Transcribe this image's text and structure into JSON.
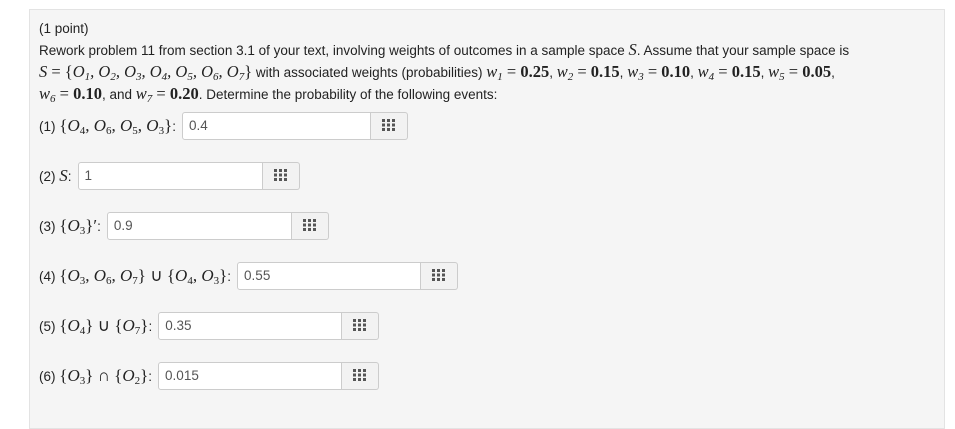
{
  "problem": {
    "points": "(1 point)",
    "intro": "Rework problem 11 from section 3.1 of your text, involving weights of outcomes in a sample space",
    "intro_tail": ". Assume that your sample space is",
    "with_weights": "with associated weights (probabilities)",
    "and_word": ", and",
    "determine": ". Determine the probability of the following events:",
    "weights": {
      "w1": "0.25",
      "w2": "0.15",
      "w3": "0.10",
      "w4": "0.15",
      "w5": "0.05",
      "w6": "0.10",
      "w7": "0.20"
    }
  },
  "answers": [
    {
      "label": "(1)",
      "value": "0.4"
    },
    {
      "label": "(2)",
      "value": "1"
    },
    {
      "label": "(3)",
      "value": "0.9"
    },
    {
      "label": "(4)",
      "value": "0.55"
    },
    {
      "label": "(5)",
      "value": "0.35"
    },
    {
      "label": "(6)",
      "value": "0.015"
    }
  ],
  "icons": {
    "matrix_button": "equation-editor-grid-icon"
  }
}
